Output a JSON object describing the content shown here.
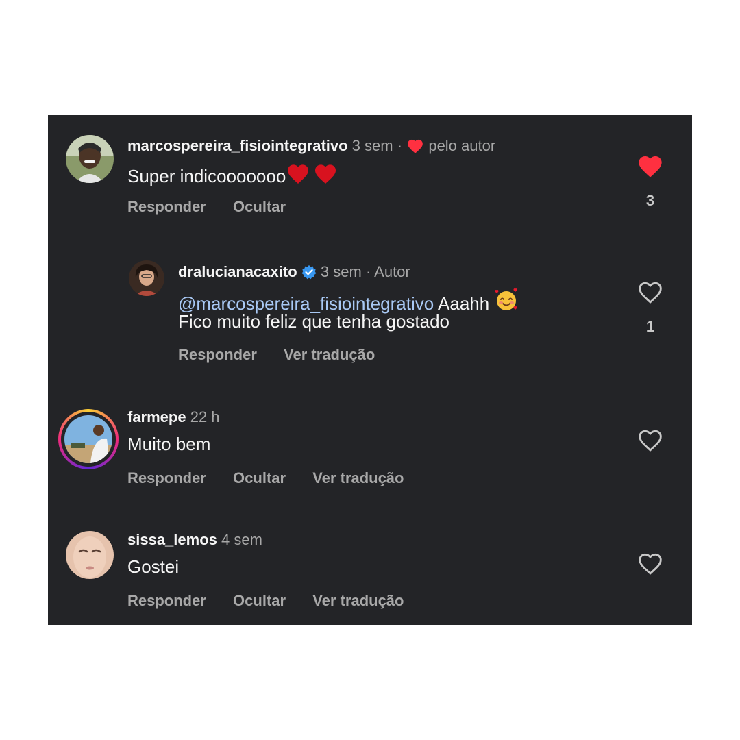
{
  "comments": [
    {
      "username": "marcospereira_fisiointegrativo",
      "time": "3 sem",
      "separator": "·",
      "by_author": "pelo autor",
      "text": "Super indicooooooo",
      "actions": [
        "Responder",
        "Ocultar"
      ],
      "liked": true,
      "like_count": "3"
    },
    {
      "username": "dralucianacaxito",
      "verified": true,
      "time": "3 sem",
      "separator": "·",
      "author_tag": "Autor",
      "mention": "@marcospereira_fisiointegrativo",
      "text_line1": "Aaahh",
      "text_line2": "Fico muito feliz que tenha gostado",
      "actions": [
        "Responder",
        "Ver tradução"
      ],
      "liked": false,
      "like_count": "1"
    },
    {
      "username": "farmepe",
      "time": "22 h",
      "text": "Muito bem",
      "actions": [
        "Responder",
        "Ocultar",
        "Ver tradução"
      ],
      "liked": false
    },
    {
      "username": "sissa_lemos",
      "time": "4 sem",
      "text": "Gostei",
      "actions": [
        "Responder",
        "Ocultar",
        "Ver tradução"
      ],
      "liked": false
    }
  ],
  "colors": {
    "background": "#232427",
    "heart_red": "#ff3040",
    "verified_blue": "#3897f0",
    "mention": "#a9c9f5",
    "muted": "#a8a8a8"
  },
  "icons": [
    "heart-icon",
    "heart-outline-icon",
    "verified-badge-icon",
    "smiling-face-with-hearts-emoji",
    "red-heart-emoji"
  ]
}
